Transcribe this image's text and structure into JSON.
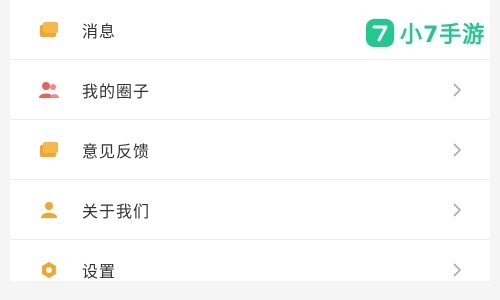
{
  "menu": {
    "items": [
      {
        "label": "消息",
        "icon": "message-icon",
        "icon_color": "#f5a623"
      },
      {
        "label": "我的圈子",
        "icon": "group-icon",
        "icon_color": "#e8615a"
      },
      {
        "label": "意见反馈",
        "icon": "feedback-icon",
        "icon_color": "#f5a623"
      },
      {
        "label": "关于我们",
        "icon": "user-icon",
        "icon_color": "#f5a623"
      },
      {
        "label": "设置",
        "icon": "settings-gear-icon",
        "icon_color": "#f5a623"
      }
    ]
  },
  "watermark": {
    "logo_glyph": "7",
    "text": "小7手游",
    "color": "#22c98f"
  }
}
